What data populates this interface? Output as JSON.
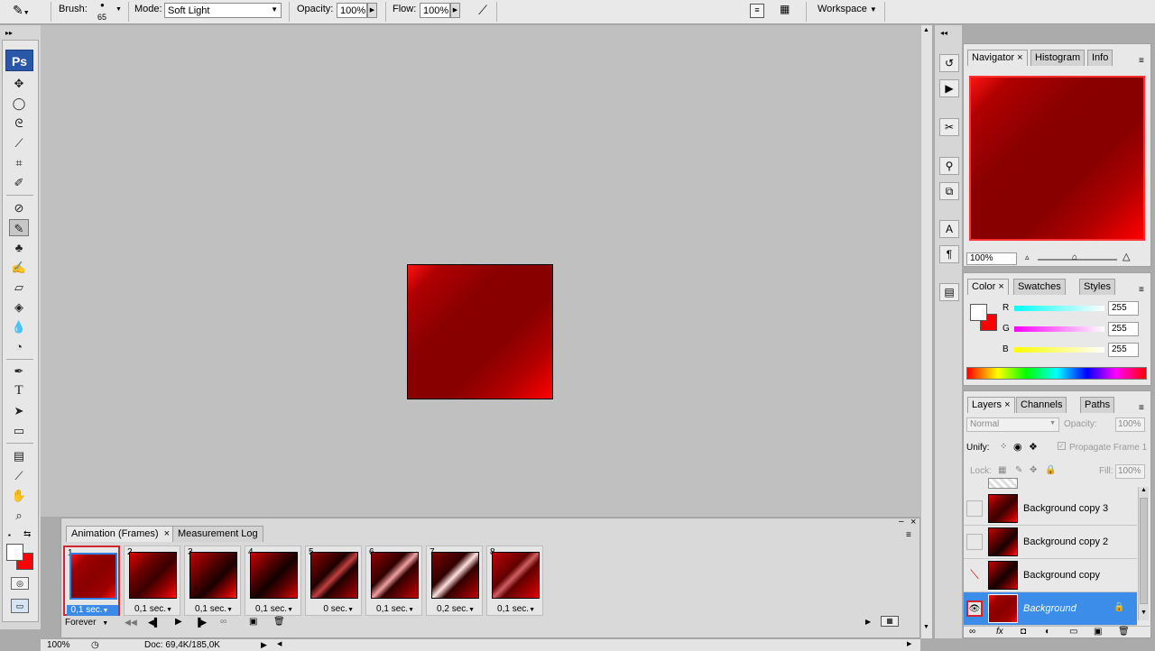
{
  "options_bar": {
    "brush_label": "Brush:",
    "brush_size": "65",
    "mode_label": "Mode:",
    "mode_value": "Soft Light",
    "opacity_label": "Opacity:",
    "opacity_value": "100%",
    "flow_label": "Flow:",
    "flow_value": "100%",
    "workspace_label": "Workspace"
  },
  "toolbox": {
    "logo": "Ps",
    "tools": [
      "move-tool",
      "marquee-tool",
      "lasso-tool",
      "magic-wand-tool",
      "crop-tool",
      "slice-tool",
      "healing-brush-tool",
      "brush-tool",
      "clone-stamp-tool",
      "history-brush-tool",
      "eraser-tool",
      "paint-bucket-tool",
      "blur-tool",
      "dodge-tool",
      "pen-tool",
      "type-tool",
      "path-selection-tool",
      "shape-tool",
      "notes-tool",
      "eyedropper-tool",
      "hand-tool",
      "zoom-tool"
    ],
    "active_tool": "brush-tool"
  },
  "animation_panel": {
    "tabs": [
      "Animation (Frames)",
      "Measurement Log"
    ],
    "frames": [
      {
        "num": "1",
        "delay": "0,1 sec."
      },
      {
        "num": "2",
        "delay": "0,1 sec."
      },
      {
        "num": "3",
        "delay": "0,1 sec."
      },
      {
        "num": "4",
        "delay": "0,1 sec."
      },
      {
        "num": "5",
        "delay": "0 sec."
      },
      {
        "num": "6",
        "delay": "0,1 sec."
      },
      {
        "num": "7",
        "delay": "0,2 sec."
      },
      {
        "num": "8",
        "delay": "0,1 sec."
      }
    ],
    "loop": "Forever"
  },
  "status_bar": {
    "zoom": "100%",
    "doc": "Doc: 69,4K/185,0K"
  },
  "navigator_panel": {
    "tabs": [
      "Navigator",
      "Histogram",
      "Info"
    ],
    "zoom": "100%"
  },
  "color_panel": {
    "tabs": [
      "Color",
      "Swatches",
      "Styles"
    ],
    "r_label": "R",
    "r_value": "255",
    "g_label": "G",
    "g_value": "255",
    "b_label": "B",
    "b_value": "255"
  },
  "layers_panel": {
    "tabs": [
      "Layers",
      "Channels",
      "Paths"
    ],
    "blend_mode": "Normal",
    "opacity_label": "Opacity:",
    "opacity_value": "100%",
    "unify_label": "Unify:",
    "propagate_label": "Propagate Frame 1",
    "lock_label": "Lock:",
    "fill_label": "Fill:",
    "fill_value": "100%",
    "layers": [
      {
        "name": "Background copy 3"
      },
      {
        "name": "Background copy 2"
      },
      {
        "name": "Background copy"
      },
      {
        "name": "Background"
      }
    ]
  },
  "colors": {
    "accent_selection": "#3c8ce9",
    "highlight_red": "#d4252c"
  }
}
